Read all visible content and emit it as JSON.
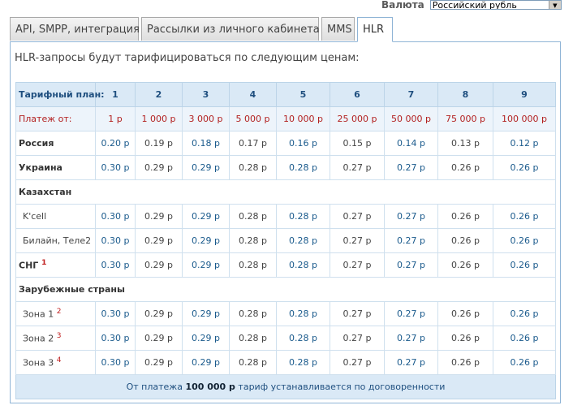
{
  "currency": {
    "label": "Валюта",
    "selected": "Российский рубль"
  },
  "tabs": [
    {
      "label": "API, SMPP, интеграция"
    },
    {
      "label": "Рассылки из личного кабинета"
    },
    {
      "label": "MMS"
    },
    {
      "label": "HLR"
    }
  ],
  "intro": "HLR-запросы будут тарифицироваться по следующим ценам:",
  "table": {
    "plan_label": "Тарифный план:",
    "plans": [
      "1",
      "2",
      "3",
      "4",
      "5",
      "6",
      "7",
      "8",
      "9"
    ],
    "payment_label": "Платеж от:",
    "payments": [
      "1 р",
      "1 000 р",
      "3 000 р",
      "5 000 р",
      "10 000 р",
      "25 000 р",
      "50 000 р",
      "75 000 р",
      "100 000 р"
    ],
    "russia": {
      "name": "Россия",
      "prices": [
        "0.20 р",
        "0.19 р",
        "0.18 р",
        "0.17 р",
        "0.16 р",
        "0.15 р",
        "0.14 р",
        "0.13 р",
        "0.12 р"
      ]
    },
    "ukraine": {
      "name": "Украина",
      "prices": [
        "0.30 р",
        "0.29 р",
        "0.29 р",
        "0.28 р",
        "0.28 р",
        "0.27 р",
        "0.27 р",
        "0.26 р",
        "0.26 р"
      ]
    },
    "kazakhstan": "Казахстан",
    "kcell": {
      "name": "K'cell",
      "prices": [
        "0.30 р",
        "0.29 р",
        "0.29 р",
        "0.28 р",
        "0.28 р",
        "0.27 р",
        "0.27 р",
        "0.26 р",
        "0.26 р"
      ]
    },
    "beeline": {
      "name": "Билайн, Теле2",
      "prices": [
        "0.30 р",
        "0.29 р",
        "0.29 р",
        "0.28 р",
        "0.28 р",
        "0.27 р",
        "0.27 р",
        "0.26 р",
        "0.26 р"
      ]
    },
    "cis": {
      "name": "СНГ",
      "note": "1",
      "prices": [
        "0.30 р",
        "0.29 р",
        "0.29 р",
        "0.28 р",
        "0.28 р",
        "0.27 р",
        "0.27 р",
        "0.26 р",
        "0.26 р"
      ]
    },
    "foreign": "Зарубежные страны",
    "zone1": {
      "name": "Зона 1",
      "note": "2",
      "prices": [
        "0.30 р",
        "0.29 р",
        "0.29 р",
        "0.28 р",
        "0.28 р",
        "0.27 р",
        "0.27 р",
        "0.26 р",
        "0.26 р"
      ]
    },
    "zone2": {
      "name": "Зона 2",
      "note": "3",
      "prices": [
        "0.30 р",
        "0.29 р",
        "0.29 р",
        "0.28 р",
        "0.28 р",
        "0.27 р",
        "0.27 р",
        "0.26 р",
        "0.26 р"
      ]
    },
    "zone3": {
      "name": "Зона 3",
      "note": "4",
      "prices": [
        "0.30 р",
        "0.29 р",
        "0.29 р",
        "0.28 р",
        "0.28 р",
        "0.27 р",
        "0.27 р",
        "0.26 р",
        "0.26 р"
      ]
    },
    "footer": {
      "before": "От платежа ",
      "amount": "100 000 р",
      "after": " тариф устанавливается по договоренности"
    }
  }
}
